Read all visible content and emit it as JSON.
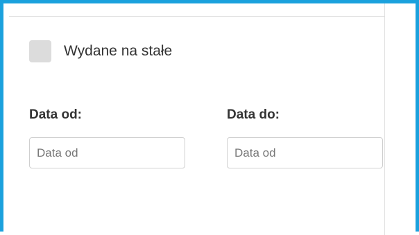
{
  "filters": {
    "permanent_checkbox": {
      "label": "Wydane na stałe",
      "checked": false
    },
    "date_from": {
      "label": "Data od:",
      "value": "",
      "placeholder": "Data od"
    },
    "date_to": {
      "label": "Data do:",
      "value": "",
      "placeholder": "Data od"
    }
  },
  "colors": {
    "frame_accent": "#1ba1dd",
    "checkbox_fill": "#dcdcdc"
  }
}
